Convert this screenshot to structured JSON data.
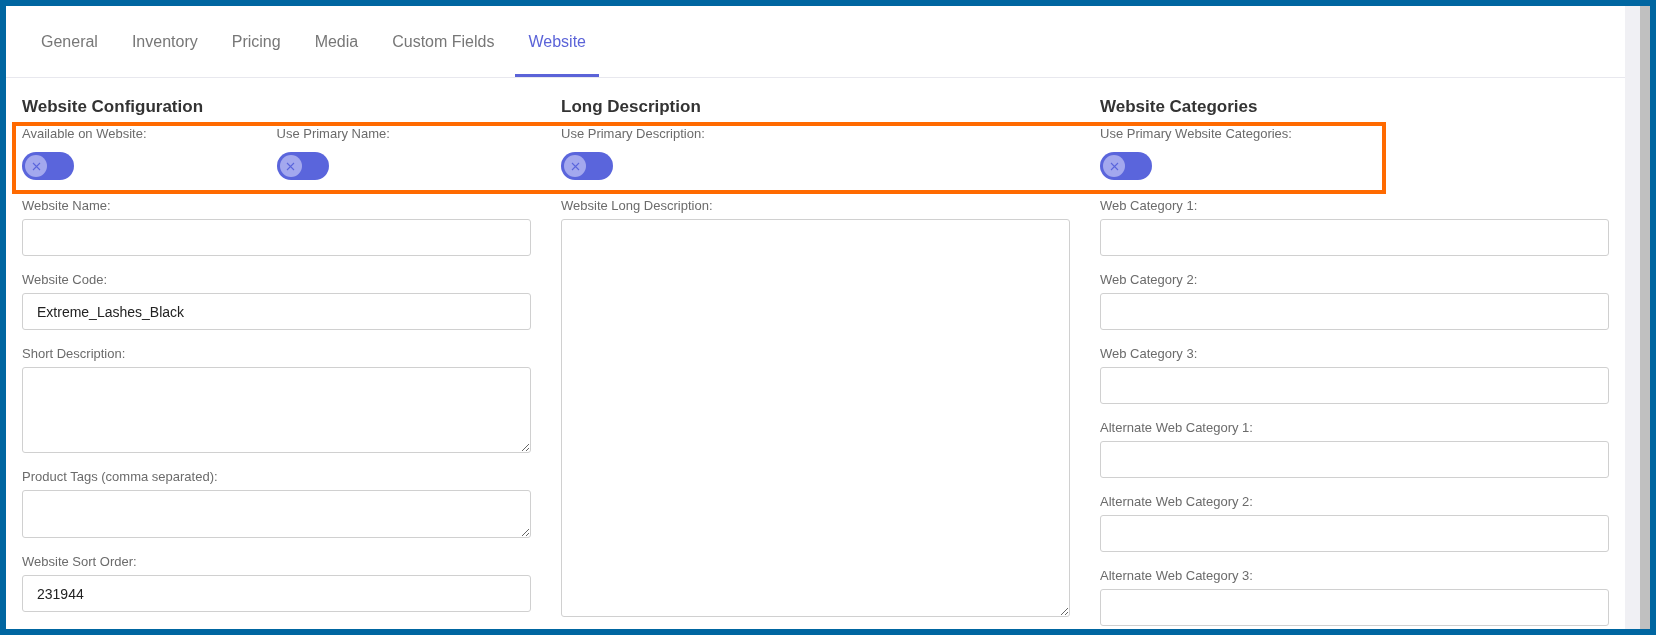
{
  "tabs": [
    {
      "label": "General",
      "selected": false
    },
    {
      "label": "Inventory",
      "selected": false
    },
    {
      "label": "Pricing",
      "selected": false
    },
    {
      "label": "Media",
      "selected": false
    },
    {
      "label": "Custom Fields",
      "selected": false
    },
    {
      "label": "Website",
      "selected": true
    }
  ],
  "columns": [
    {
      "heading": "Website Configuration",
      "toggles": [
        {
          "label": "Available on Website:",
          "on": false
        },
        {
          "label": "Use Primary Name:",
          "on": false
        }
      ],
      "fields": [
        {
          "label": "Website Name:",
          "kind": "input"
        },
        {
          "label": "Website Code:",
          "kind": "input",
          "value": "Extreme_Lashes_Black"
        },
        {
          "label": "Short Description:",
          "kind": "textarea"
        },
        {
          "label": "Product Tags (comma separated):",
          "kind": "textarea"
        },
        {
          "label": "Website Sort Order:",
          "kind": "input",
          "value": "231944"
        }
      ]
    },
    {
      "heading": "Long Description",
      "toggles": [
        {
          "label": "Use Primary Description:",
          "on": false
        }
      ],
      "fields": [
        {
          "label": "Website Long Description:",
          "kind": "textarea"
        }
      ]
    },
    {
      "heading": "Website Categories",
      "toggles": [
        {
          "label": "Use Primary Website Categories:",
          "on": false
        }
      ],
      "fields": [
        {
          "label": "Web Category 1:",
          "kind": "input"
        },
        {
          "label": "Web Category 2:",
          "kind": "input"
        },
        {
          "label": "Web Category 3:",
          "kind": "input"
        },
        {
          "label": "Alternate Web Category 1:",
          "kind": "input"
        },
        {
          "label": "Alternate Web Category 2:",
          "kind": "input"
        },
        {
          "label": "Alternate Web Category 3:",
          "kind": "input"
        }
      ]
    }
  ]
}
